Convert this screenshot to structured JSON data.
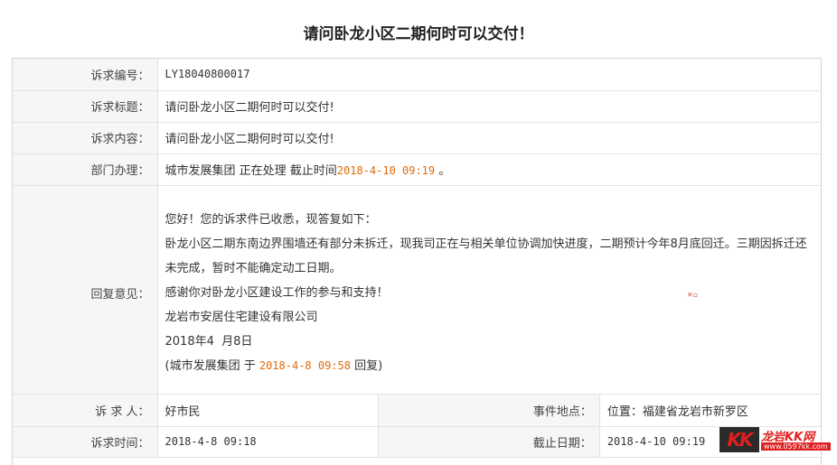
{
  "page": {
    "title": "请问卧龙小区二期何时可以交付！"
  },
  "fields": {
    "code_label": "诉求编号：",
    "code_value": "LY18040800017",
    "subject_label": "诉求标题：",
    "subject_value": "请问卧龙小区二期何时可以交付!",
    "content_label": "诉求内容：",
    "content_value": "请问卧龙小区二期何时可以交付!",
    "dept_label": "部门办理：",
    "dept_value": "城市发展集团 正在处理 截止时间",
    "dept_deadline": "2018-4-10 09:19",
    "dept_suffix": "。",
    "reply_label": "回复意见："
  },
  "reply": {
    "greeting": "您好！您的诉求件已收悉，现答复如下：",
    "body": "卧龙小区二期东南边界围墙还有部分未拆迁，现我司正在与相关单位协调加快进度，二期预计今年8月底回迁。三期因拆迁还未完成，暂时不能确定动工日期。",
    "thanks": "感谢你对卧龙小区建设工作的参与和支持！",
    "company": "龙岩市安居住宅建设有限公司",
    "date": "2018年4  月8日",
    "meta_prefix": "(城市发展集团 于 ",
    "meta_time": "2018-4-8 09:58",
    "meta_suffix": " 回复)"
  },
  "bottom": {
    "person_label": "诉 求 人：",
    "person_value": "好市民",
    "place_label": "事件地点：",
    "place_value": "位置：福建省龙岩市新罗区",
    "time_label": "诉求时间：",
    "time_value": "2018-4-8 09:18",
    "deadline_label": "截止日期：",
    "deadline_value": "2018-4-10 09:19"
  },
  "watermark": {
    "logo_text": "KK",
    "site_name": "龙岩KK网",
    "site_url": "www.0597kk.com"
  },
  "colors": {
    "accent_orange": "#e06a0b",
    "label_bg": "#f6f6f6",
    "border": "#e3e3e3"
  }
}
